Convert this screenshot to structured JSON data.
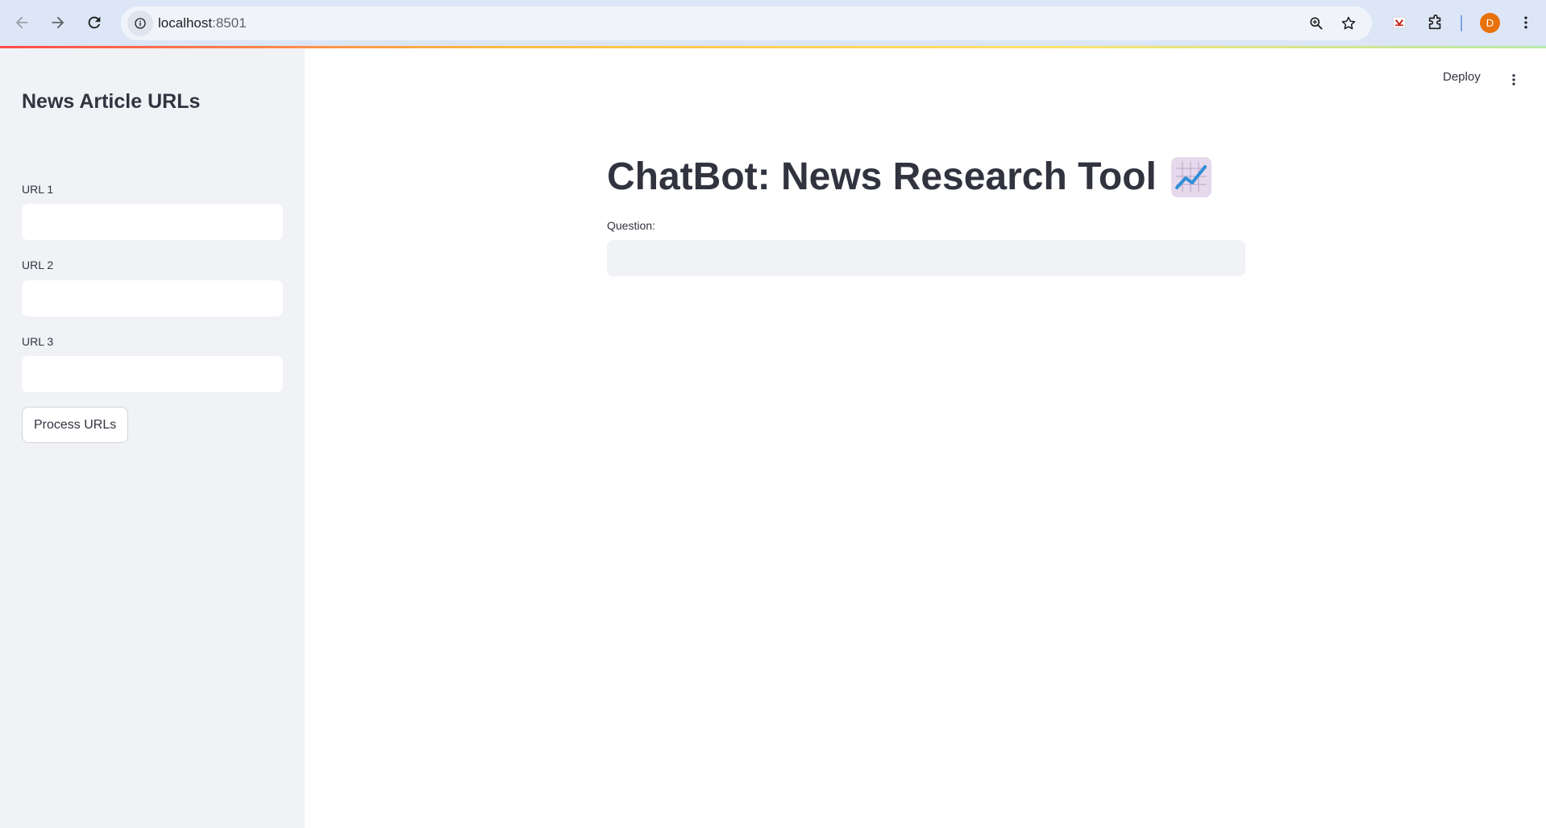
{
  "browser": {
    "url_host": "localhost",
    "url_port": ":8501",
    "avatar_letter": "D",
    "icons": [
      "back-icon",
      "forward-icon",
      "reload-icon",
      "site-info-icon",
      "zoom-icon",
      "bookmark-star-icon",
      "extension-shield-icon",
      "extensions-puzzle-icon",
      "kebab-menu-icon"
    ]
  },
  "sidebar": {
    "title": "News Article URLs",
    "fields": [
      {
        "label": "URL 1",
        "value": ""
      },
      {
        "label": "URL 2",
        "value": ""
      },
      {
        "label": "URL 3",
        "value": ""
      }
    ],
    "process_button_label": "Process URLs"
  },
  "main": {
    "deploy_label": "Deploy",
    "title": "ChatBot: News Research Tool",
    "title_emoji": "chart-increasing-icon",
    "question_label": "Question:",
    "question_value": ""
  },
  "colors": {
    "sidebar_bg": "#f0f2f6",
    "text": "#31333f",
    "browser_bar": "#dce6f6",
    "avatar": "#e8710a",
    "emoji_bg": "#e6d9ec"
  }
}
